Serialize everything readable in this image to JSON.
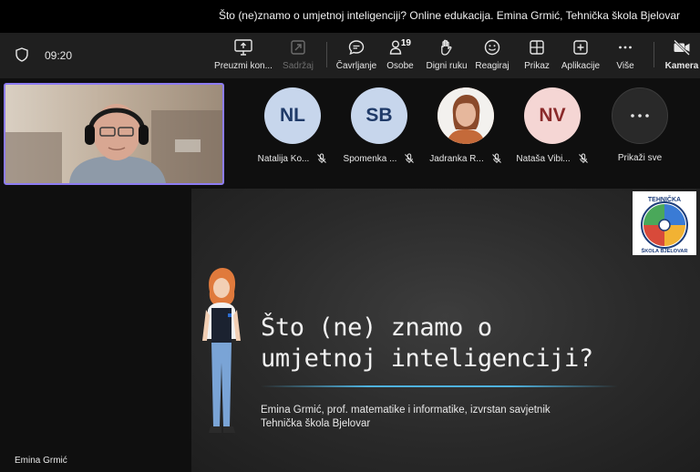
{
  "window": {
    "title": "Što (ne)znamo o umjetnoj inteligenciji? Online edukacija. Emina Grmić, Tehnička škola Bjelovar"
  },
  "toolbar": {
    "time": "09:20",
    "buttons": [
      {
        "label": "Preuzmi kon...",
        "icon": "share-screen-icon",
        "disabled": false
      },
      {
        "label": "Sadržaj",
        "icon": "content-icon",
        "disabled": true
      },
      {
        "label": "Čavrljanje",
        "icon": "chat-icon",
        "disabled": false
      },
      {
        "label": "Osobe",
        "icon": "people-icon",
        "count": "19",
        "disabled": false
      },
      {
        "label": "Digni ruku",
        "icon": "raise-hand-icon",
        "disabled": false
      },
      {
        "label": "Reagiraj",
        "icon": "react-icon",
        "disabled": false
      },
      {
        "label": "Prikaz",
        "icon": "view-icon",
        "disabled": false
      },
      {
        "label": "Aplikacije",
        "icon": "apps-plus-icon",
        "disabled": false
      },
      {
        "label": "Više",
        "icon": "more-icon",
        "disabled": false
      },
      {
        "label": "Kamera",
        "icon": "camera-off-icon",
        "disabled": false
      }
    ]
  },
  "participants": [
    {
      "initials": "NL",
      "name": "Natalija Ko...",
      "avatar_bg": "#c7d6ec",
      "avatar_fg": "#1f3a68",
      "muted": true
    },
    {
      "initials": "SB",
      "name": "Spomenka ...",
      "avatar_bg": "#c7d6ec",
      "avatar_fg": "#1f3a68",
      "muted": true
    },
    {
      "initials": "",
      "name": "Jadranka R...",
      "avatar_bg": "#b06b4a",
      "avatar_fg": "#ffffff",
      "muted": true,
      "photo": true
    },
    {
      "initials": "NV",
      "name": "Nataša Vibi...",
      "avatar_bg": "#f5d6d4",
      "avatar_fg": "#8a2a2a",
      "muted": true
    }
  ],
  "show_all": {
    "label": "Prikaži sve"
  },
  "slide": {
    "title_line1": "Što (ne) znamo o",
    "title_line2": "umjetnoj inteligenciji?",
    "subtitle_line1": "Emina Grmić, prof. matematike i informatike, izvrstan savjetnik",
    "subtitle_line2": "Tehnička škola Bjelovar",
    "logo_text_top": "TEHNIČKA",
    "logo_text_bottom": "ŠKOLA BJELOVAR"
  },
  "speaker": {
    "name": "Emina Grmić"
  },
  "colors": {
    "toolbar_bg": "#1f1f1f",
    "self_video_border": "#8d7cf3",
    "slide_rule": "#4fb3e0"
  }
}
